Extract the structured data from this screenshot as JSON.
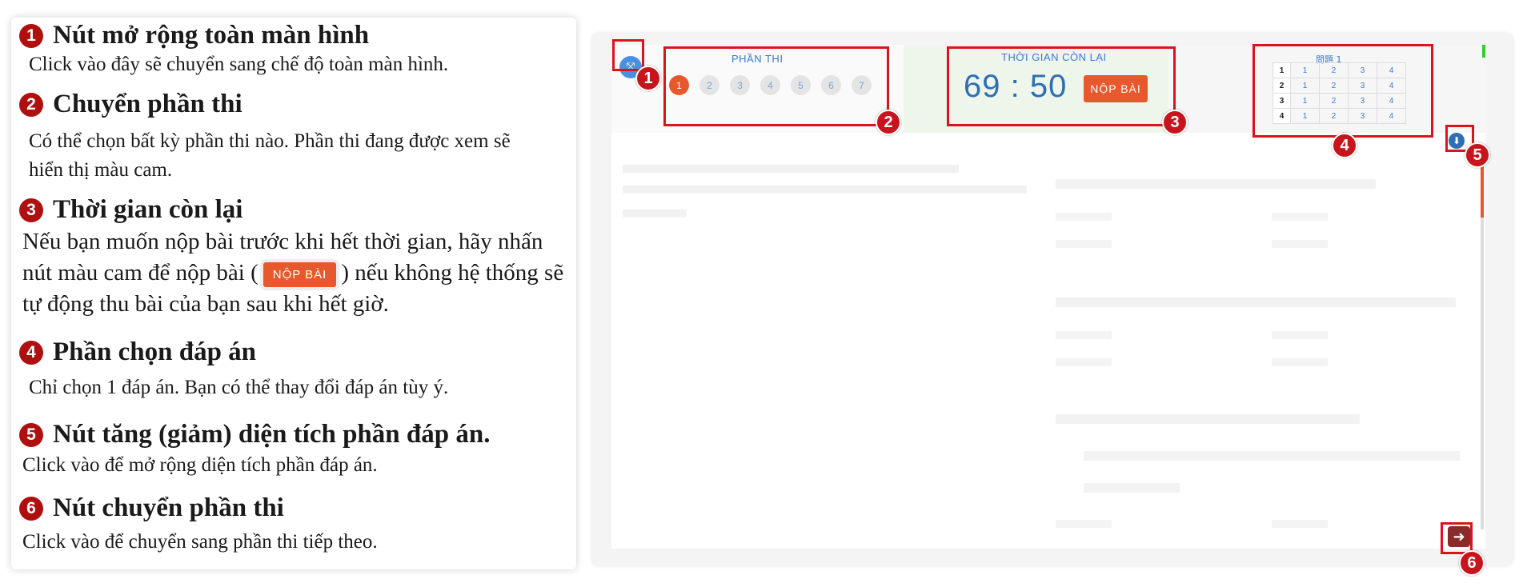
{
  "guide": {
    "sections": [
      {
        "num": "1",
        "title": "Nút mở rộng toàn màn hình",
        "text": "Click vào đây sẽ chuyển sang chế độ toàn màn hình."
      },
      {
        "num": "2",
        "title": "Chuyển phần thi",
        "text": "Có thể chọn bất kỳ phần thi nào. Phần thi đang được xem sẽ hiển thị màu cam."
      },
      {
        "num": "3",
        "title": "Thời gian còn lại",
        "text_before": "Nếu bạn muốn nộp bài trước khi hết thời gian, hãy nhấn nút màu cam để nộp bài (",
        "button": "NỘP BÀI",
        "text_after": ") nếu không hệ thống sẽ tự động thu bài của bạn sau khi hết giờ."
      },
      {
        "num": "4",
        "title": "Phần chọn đáp án",
        "text": "Chỉ chọn 1 đáp án. Bạn có thể thay đổi đáp án tùy ý."
      },
      {
        "num": "5",
        "title": "Nút tăng (giảm) diện tích phần đáp án.",
        "text": "Click vào để mở rộng diện tích phần đáp án."
      },
      {
        "num": "6",
        "title": "Nút chuyển phần thi",
        "text": "Click vào để chuyển sang phần thi tiếp theo."
      }
    ]
  },
  "screen": {
    "part_label": "PHẦN THI",
    "parts": [
      "1",
      "2",
      "3",
      "4",
      "5",
      "6",
      "7"
    ],
    "active_part": "1",
    "time_label": "THỜI GIAN CÒN LẠI",
    "timer": "69 : 50",
    "submit_label": "NỘP BÀI",
    "answer_title": "問題 1",
    "answer_rows": [
      {
        "q": "1",
        "options": [
          "1",
          "2",
          "3",
          "4"
        ]
      },
      {
        "q": "2",
        "options": [
          "1",
          "2",
          "3",
          "4"
        ]
      },
      {
        "q": "3",
        "options": [
          "1",
          "2",
          "3",
          "4"
        ]
      },
      {
        "q": "4",
        "options": [
          "1",
          "2",
          "3",
          "4"
        ]
      }
    ],
    "markers": [
      "1",
      "2",
      "3",
      "4",
      "5",
      "6"
    ]
  },
  "colors": {
    "accent": "#e8582d",
    "marker": "#c8141c",
    "blue": "#2d6fb3"
  }
}
